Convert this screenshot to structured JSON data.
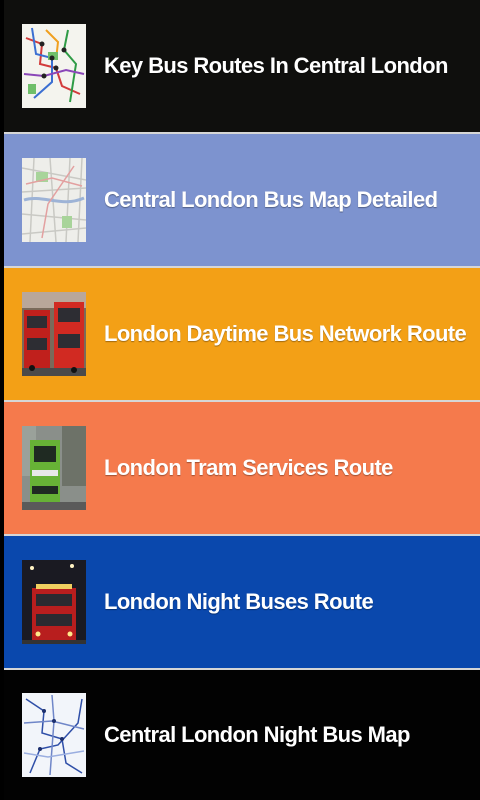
{
  "colors": {
    "screen_background": "#000000",
    "divider": "#d6d6d6",
    "label_text": "#ffffff"
  },
  "routes": [
    {
      "label": "Key Bus Routes In Central London",
      "background": "#0f0f0d",
      "thumbnail": "bus-routes-map-icon"
    },
    {
      "label": "Central London Bus Map Detailed",
      "background": "#7d93cf",
      "thumbnail": "street-map-icon"
    },
    {
      "label": "London Daytime Bus Network Route",
      "background": "#f3a016",
      "thumbnail": "double-decker-buses-photo"
    },
    {
      "label": "London Tram Services Route",
      "background": "#f57a4c",
      "thumbnail": "tram-photo"
    },
    {
      "label": "London Night Buses Route",
      "background": "#0a48ad",
      "thumbnail": "night-bus-photo"
    },
    {
      "label": "Central London Night Bus Map",
      "background": "#020202",
      "thumbnail": "night-bus-map-icon"
    }
  ]
}
